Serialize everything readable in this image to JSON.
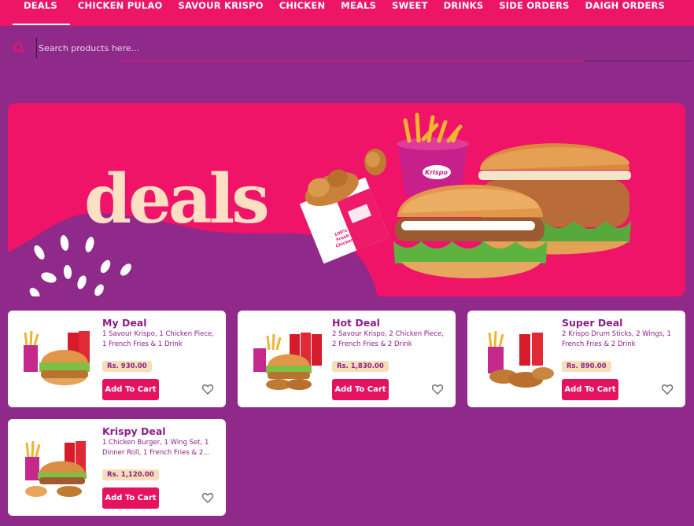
{
  "nav": {
    "tabs": [
      {
        "label": "DEALS",
        "active": true
      },
      {
        "label": "CHICKEN PULAO"
      },
      {
        "label": "SAVOUR KRISPO"
      },
      {
        "label": "CHICKEN"
      },
      {
        "label": "MEALS"
      },
      {
        "label": "SWEET"
      },
      {
        "label": "DRINKS"
      },
      {
        "label": "SIDE ORDERS"
      },
      {
        "label": "DAIGH ORDERS"
      }
    ]
  },
  "search": {
    "placeholder": "Search products here..."
  },
  "banner": {
    "title": "deals",
    "cup_brand": "Krispo",
    "box_label": "100% Fresh Chicken"
  },
  "products": [
    {
      "name": "My Deal",
      "description": "1 Savour Krispo, 1 Chicken Piece, 1 French Fries & 1 Drink",
      "price": "Rs. 930.00",
      "button": "Add To Cart"
    },
    {
      "name": "Hot Deal",
      "description": "2 Savour Krispo, 2 Chicken Piece, 2 French Fries & 2 Drink",
      "price": "Rs. 1,830.00",
      "button": "Add To Cart"
    },
    {
      "name": "Super Deal",
      "description": "2 Krispo Drum Sticks, 2 Wings, 1 French Fries & 2 Drink",
      "price": "Rs. 890.00",
      "button": "Add To Cart"
    },
    {
      "name": "Krispy Deal",
      "description": "1 Chicken Burger, 1 Wing Set, 1 Dinner Roll, 1 French Fries & 2...",
      "price": "Rs. 1,120.00",
      "button": "Add To Cart"
    }
  ],
  "colors": {
    "nav": "#ec1566",
    "background": "#8f2a8a",
    "accent": "#e5135f",
    "banner": "#ef1467"
  }
}
